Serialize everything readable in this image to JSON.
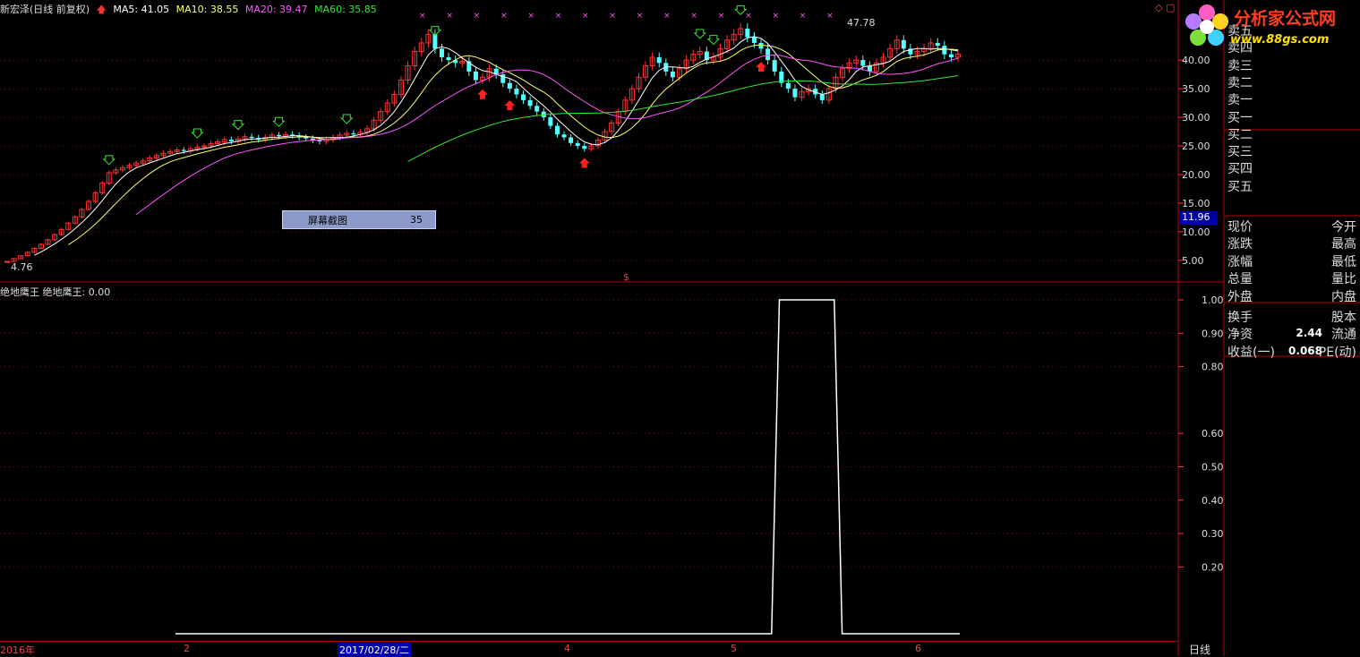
{
  "header": {
    "stock_title": "新宏泽(日线 前复权)",
    "ma5": "MA5: 41.05",
    "ma10": "MA10: 38.55",
    "ma20": "MA20: 39.47",
    "ma60": "MA60: 35.85"
  },
  "colors": {
    "up": "#ff3232",
    "down": "#54ffff",
    "ma5": "#ffffff",
    "ma10": "#ffff66",
    "ma20": "#ff54ff",
    "ma60": "#32e832",
    "grid": "#8b0000",
    "axis": "#ff3232"
  },
  "annotations": {
    "high_label": "47.78",
    "low_label": "4.76",
    "mid_marker": "$"
  },
  "screenshot_box": {
    "label": "屏幕截图",
    "value": "35"
  },
  "indicator": {
    "title": "绝地鹰王",
    "value_text": "绝地鹰王: 0.00"
  },
  "price_axis": [
    "40.00",
    "35.00",
    "30.00",
    "25.00",
    "20.00",
    "15.00",
    "10.00",
    "5.00"
  ],
  "current_price_tag": "11.96",
  "indicator_axis": [
    "1.00",
    "0.90",
    "0.80",
    "0.60",
    "0.50",
    "0.40",
    "0.30",
    "0.20"
  ],
  "date_axis": {
    "labels": [
      "2016年",
      "2",
      "2017/02/28/二",
      "4",
      "5",
      "6"
    ],
    "selected": "2017/02/28/二"
  },
  "period_tab": "日线",
  "logo": {
    "name": "分析家公式网",
    "url_text": "www.88gs.com"
  },
  "right_panel": {
    "order_book": [
      "卖五",
      "卖四",
      "卖三",
      "卖二",
      "卖一",
      "买一",
      "买二",
      "买三",
      "买四",
      "买五"
    ],
    "quote_rows": [
      {
        "left": "现价",
        "right": "今开"
      },
      {
        "left": "涨跌",
        "right": "最高"
      },
      {
        "left": "涨幅",
        "right": "最低"
      },
      {
        "left": "总量",
        "right": "量比"
      },
      {
        "left": "外盘",
        "right": "内盘"
      },
      {
        "left": "换手",
        "right": "股本"
      },
      {
        "left": "净资",
        "value": "2.44",
        "right": "流通"
      },
      {
        "left": "收益(一)",
        "value": "0.068",
        "right": "PE(动)"
      }
    ]
  },
  "chart_data": [
    {
      "type": "candlestick",
      "title": "新宏泽(日线 前复权)",
      "ylim": [
        2,
        48
      ],
      "x": [
        0,
        1,
        2,
        3,
        4,
        5,
        6,
        7,
        8,
        9,
        10,
        11,
        12,
        13,
        14,
        15,
        16,
        17,
        18,
        19,
        20,
        21,
        22,
        23,
        24,
        25,
        26,
        27,
        28,
        29,
        30,
        31,
        32,
        33,
        34,
        35,
        36,
        37,
        38,
        39,
        40,
        41,
        42,
        43,
        44,
        45,
        46,
        47,
        48,
        49,
        50,
        51,
        52,
        53,
        54,
        55,
        56,
        57,
        58,
        59,
        60,
        61,
        62,
        63,
        64,
        65,
        66,
        67,
        68,
        69,
        70,
        71,
        72,
        73,
        74,
        75,
        76,
        77,
        78,
        79,
        80,
        81,
        82,
        83,
        84,
        85,
        86,
        87,
        88,
        89,
        90,
        91,
        92,
        93,
        94,
        95,
        96,
        97,
        98,
        99,
        100,
        101,
        102,
        103,
        104,
        105,
        106,
        107,
        108,
        109,
        110,
        111,
        112,
        113,
        114,
        115,
        116,
        117,
        118,
        119,
        120,
        121,
        122,
        123,
        124,
        125,
        126,
        127,
        128,
        129,
        130,
        131,
        132,
        133,
        134,
        135,
        136,
        137,
        138,
        139,
        140
      ],
      "close": [
        4.8,
        5.3,
        5.8,
        6.4,
        7.1,
        7.8,
        8.6,
        9.5,
        10.4,
        11.5,
        12.6,
        13.9,
        15.3,
        16.8,
        18.5,
        20.3,
        20.8,
        21.2,
        21.6,
        22.0,
        22.4,
        22.9,
        23.3,
        23.7,
        24.0,
        24.3,
        24.1,
        24.5,
        24.8,
        25.0,
        25.4,
        25.7,
        26.1,
        25.8,
        26.2,
        26.6,
        26.4,
        26.1,
        26.5,
        26.9,
        26.7,
        27.0,
        26.8,
        26.5,
        26.3,
        26.0,
        25.8,
        26.1,
        26.5,
        26.9,
        27.2,
        27.0,
        27.4,
        28.0,
        29.5,
        31.0,
        32.5,
        34.0,
        36.5,
        39.0,
        41.5,
        43.0,
        44.5,
        42.0,
        40.5,
        40.0,
        39.5,
        39.8,
        38.0,
        36.5,
        37.0,
        38.5,
        37.5,
        36.0,
        35.0,
        34.0,
        33.0,
        32.0,
        31.0,
        30.0,
        28.5,
        27.0,
        26.5,
        25.5,
        25.0,
        24.5,
        25.0,
        26.0,
        27.5,
        29.0,
        31.0,
        33.0,
        35.0,
        37.0,
        39.0,
        40.5,
        39.5,
        38.0,
        37.0,
        38.5,
        40.0,
        41.0,
        41.5,
        40.0,
        40.5,
        42.0,
        43.5,
        44.5,
        45.5,
        44.0,
        43.0,
        42.0,
        40.0,
        38.0,
        36.0,
        35.0,
        33.5,
        34.5,
        35.0,
        34.0,
        33.0,
        35.0,
        37.0,
        38.5,
        39.5,
        40.0,
        39.0,
        38.0,
        39.5,
        40.5,
        42.0,
        43.5,
        42.0,
        41.0,
        41.5,
        42.0,
        43.0,
        42.5,
        41.0,
        40.5,
        41.0
      ],
      "ma5": [],
      "note_markers": {
        "sell": [
          15,
          28,
          34,
          40,
          50,
          63,
          102,
          104,
          108
        ],
        "buy": [
          70,
          74,
          85,
          111
        ]
      }
    },
    {
      "type": "line",
      "title": "绝地鹰王",
      "ylim": [
        0,
        1.05
      ],
      "x": [
        0,
        10,
        20,
        30,
        40,
        50,
        60,
        70,
        76,
        77,
        78,
        84,
        85,
        95,
        100
      ],
      "y": [
        0,
        0,
        0,
        0,
        0,
        0,
        0,
        0,
        0,
        1,
        1,
        1,
        0,
        0,
        0
      ]
    }
  ]
}
